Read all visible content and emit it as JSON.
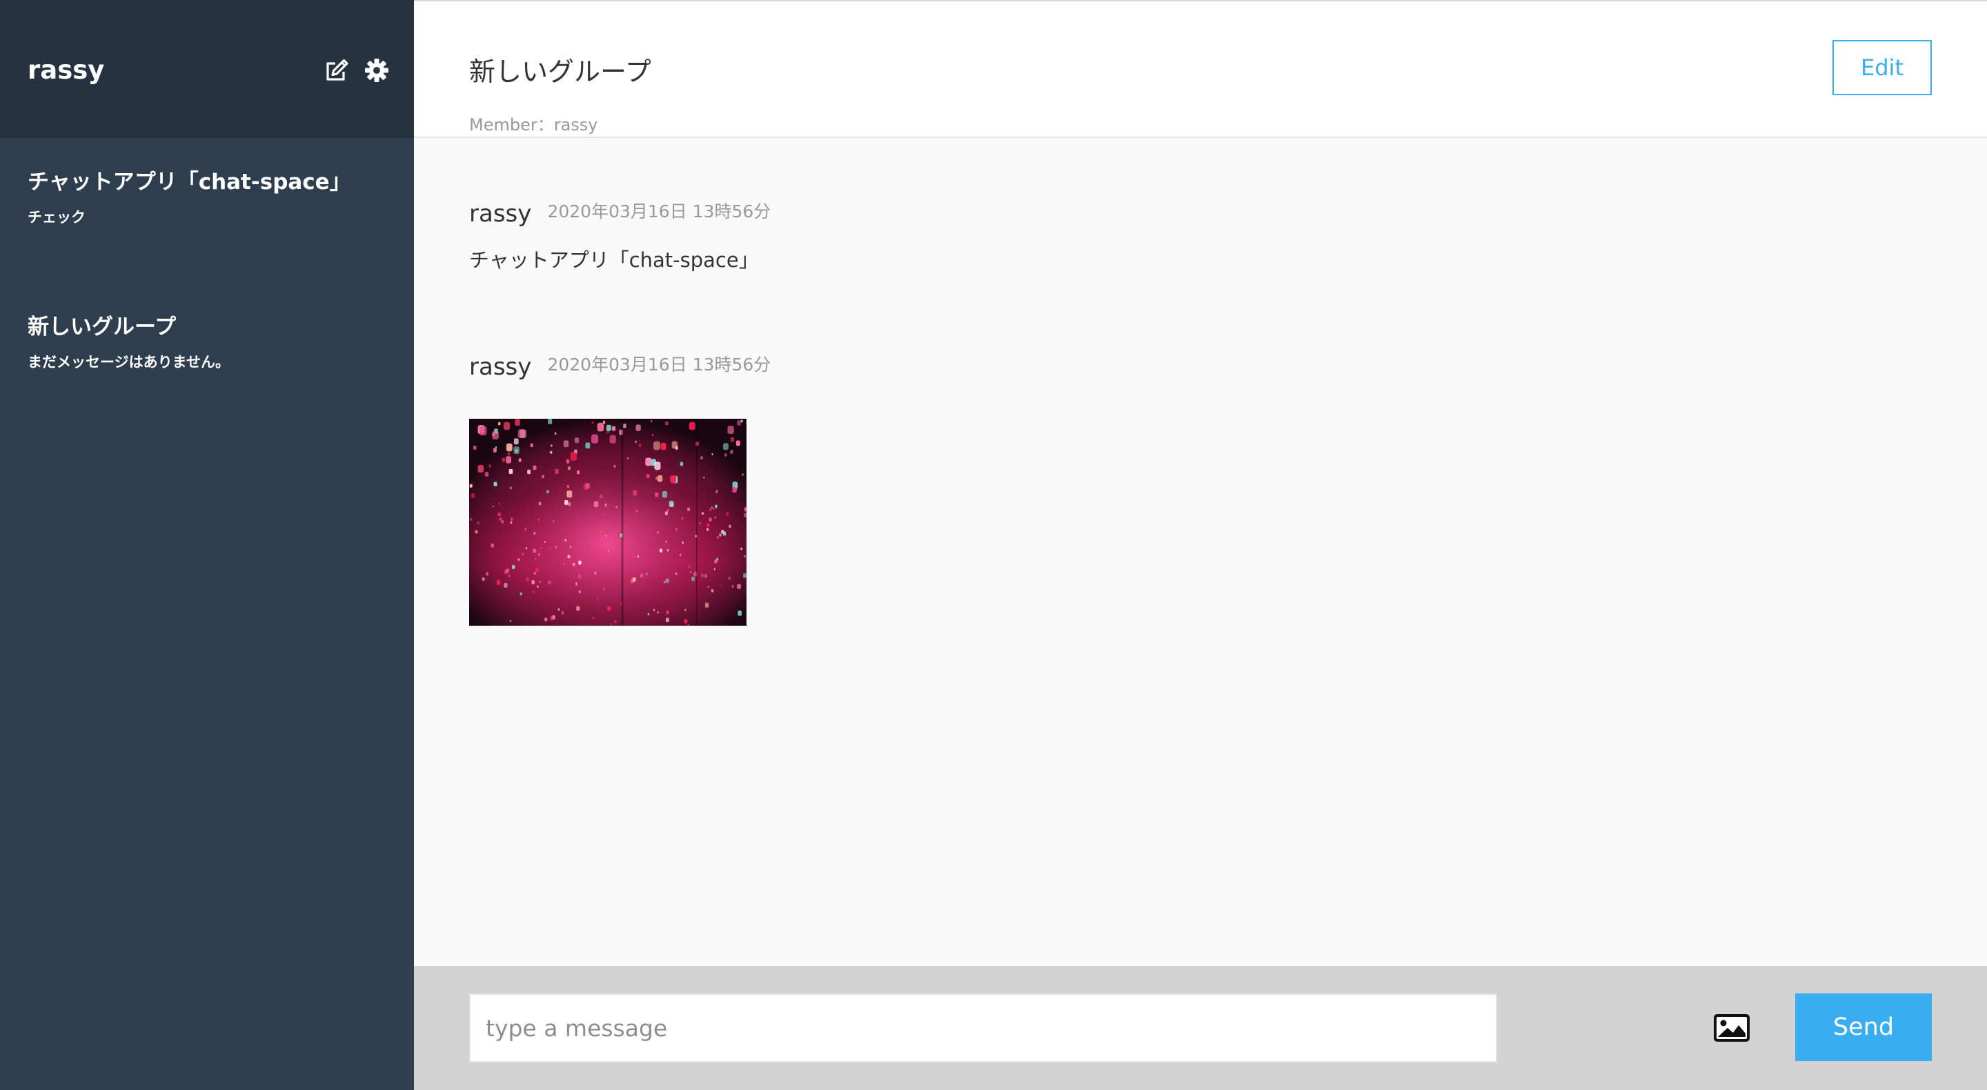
{
  "sidebar": {
    "user_name": "rassy",
    "groups": [
      {
        "name": "チャットアプリ「chat-space」",
        "last_message": "チェック"
      },
      {
        "name": "新しいグループ",
        "last_message": "まだメッセージはありません。"
      }
    ]
  },
  "header": {
    "group_title": "新しいグループ",
    "members": "Member：rassy",
    "edit_label": "Edit"
  },
  "messages": [
    {
      "user": "rassy",
      "date": "2020年03月16日 13時56分",
      "text": "チャットアプリ「chat-space」"
    },
    {
      "user": "rassy",
      "date": "2020年03月16日 13時56分",
      "image": "photo-lantern-installation"
    }
  ],
  "form": {
    "placeholder": "type a message",
    "send_label": "Send"
  },
  "icons": {
    "edit": "edit-icon",
    "settings": "gear-icon",
    "image_upload": "image-icon"
  },
  "colors": {
    "sidebar_bg": "#2e3e4f",
    "sidebar_header_bg": "#253240",
    "accent": "#38aef0",
    "footer_bg": "#d3d3d3"
  }
}
